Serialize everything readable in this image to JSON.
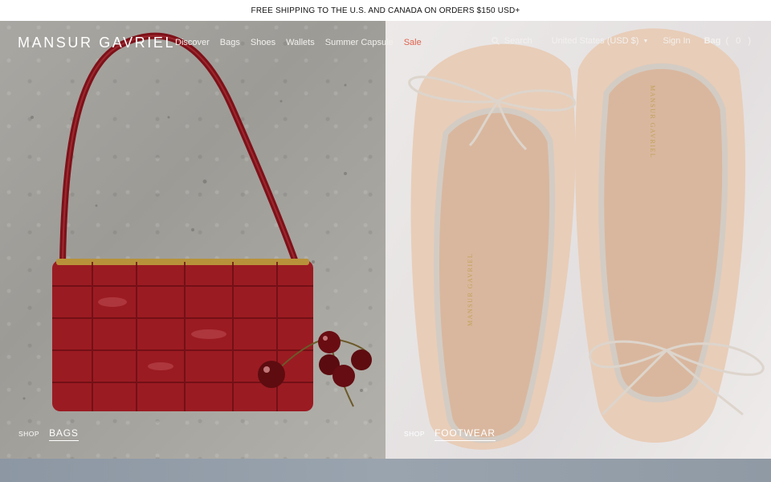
{
  "promo": {
    "text": "FREE SHIPPING TO THE U.S. AND CANADA ON ORDERS $150 USD+"
  },
  "header": {
    "logo": "MANSUR GAVRIEL",
    "nav": {
      "discover": "Discover",
      "bags": "Bags",
      "shoes": "Shoes",
      "wallets": "Wallets",
      "summer_capsule": "Summer Capsule",
      "sale": "Sale"
    },
    "utility": {
      "search": "Search",
      "region": "United States (USD $)",
      "sign_in": "Sign In",
      "bag": "Bag",
      "bag_count": "( 0 )"
    }
  },
  "hero": {
    "bags": {
      "shop_prefix": "SHOP",
      "category": "BAGS",
      "insole_brand": ""
    },
    "footwear": {
      "shop_prefix": "SHOP",
      "category": "FOOTWEAR",
      "insole_brand": "MANSUR GAVRIEL"
    }
  },
  "colors": {
    "accent_sale": "#e0644f",
    "bag_red": "#9b1b22",
    "shoe_nude": "#e8cdb8",
    "footer_blue": "#9aa4af"
  },
  "icons": {
    "search": "search-icon",
    "caret": "chevron-down-icon"
  }
}
